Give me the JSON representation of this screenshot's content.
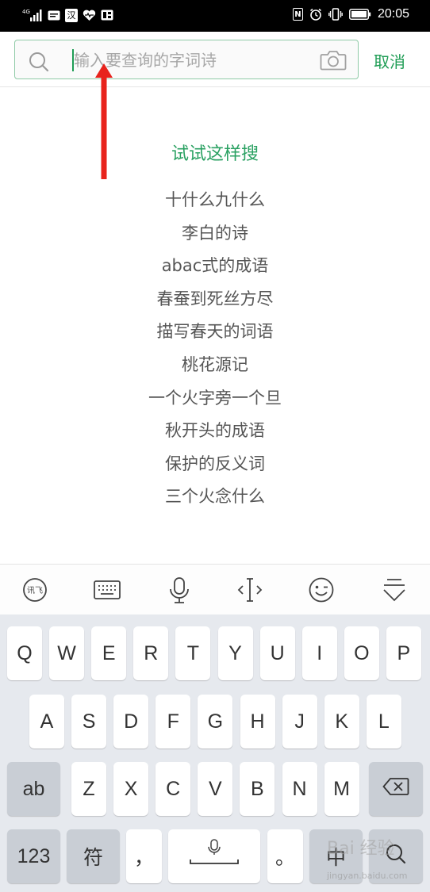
{
  "status_bar": {
    "network": "4G",
    "han_badge": "汉",
    "nfc": "N",
    "time": "20:05"
  },
  "search": {
    "placeholder": "输入要查询的字词诗",
    "value": "",
    "cancel_label": "取消"
  },
  "suggestions": {
    "title": "试试这样搜",
    "items": [
      "十什么九什么",
      "李白的诗",
      "abac式的成语",
      "春蚕到死丝方尽",
      "描写春天的词语",
      "桃花源记",
      "一个火字旁一个旦",
      "秋开头的成语",
      "保护的反义词",
      "三个火念什么"
    ]
  },
  "keyboard": {
    "toolbar_icons": [
      "ime-logo-icon",
      "keyboard-icon",
      "microphone-icon",
      "cursor-move-icon",
      "emoji-icon",
      "collapse-keyboard-icon"
    ],
    "row1": [
      "Q",
      "W",
      "E",
      "R",
      "T",
      "Y",
      "U",
      "I",
      "O",
      "P"
    ],
    "row2": [
      "A",
      "S",
      "D",
      "F",
      "G",
      "H",
      "J",
      "K",
      "L"
    ],
    "row3": [
      "Z",
      "X",
      "C",
      "V",
      "B",
      "N",
      "M"
    ],
    "ab_label": "ab",
    "num_label": "123",
    "symbol_label": "符",
    "comma_label": "，",
    "period_label": "。",
    "lang_label": "中"
  },
  "watermark": {
    "text": "Bai 经验",
    "url": "jingyan.baidu.com"
  },
  "colors": {
    "accent_green": "#1f9d55",
    "annotation_red": "#e8231c",
    "keyboard_bg": "#e6e9ee"
  }
}
